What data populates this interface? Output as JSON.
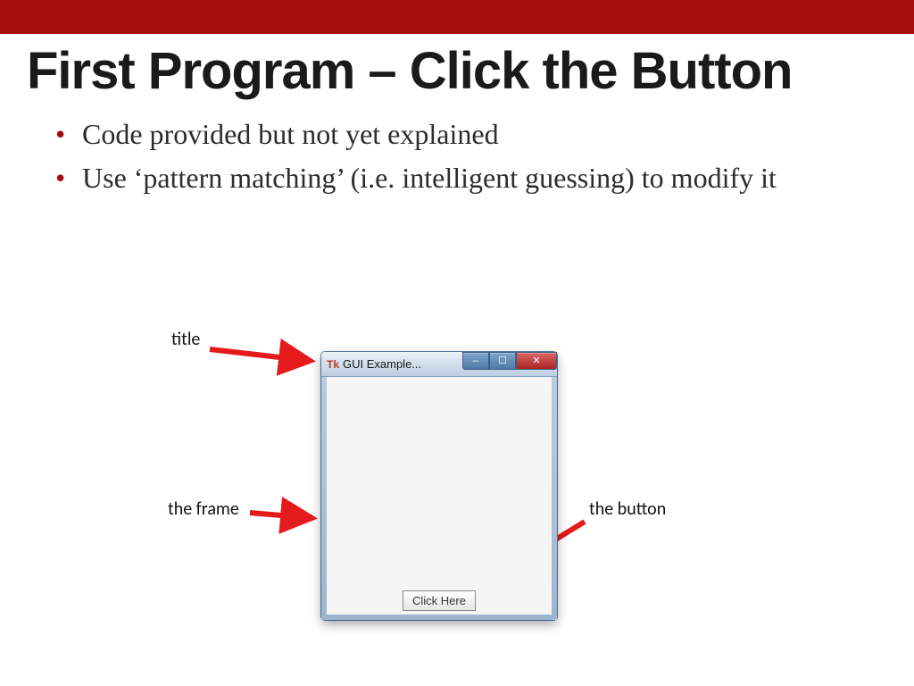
{
  "slide": {
    "heading": "First Program – Click the Button",
    "bullets": [
      "Code provided but not yet explained",
      "Use ‘pattern matching’ (i.e. intelligent guessing) to modify it"
    ]
  },
  "labels": {
    "title": "title",
    "frame": "the frame",
    "button": "the button"
  },
  "window": {
    "app_icon": "Tk",
    "title": "GUI Example...",
    "min": "–",
    "max": "☐",
    "close": "✕",
    "button_label": "Click Here"
  },
  "colors": {
    "bar": "#a80d0d",
    "arrow": "#e41a1c"
  }
}
